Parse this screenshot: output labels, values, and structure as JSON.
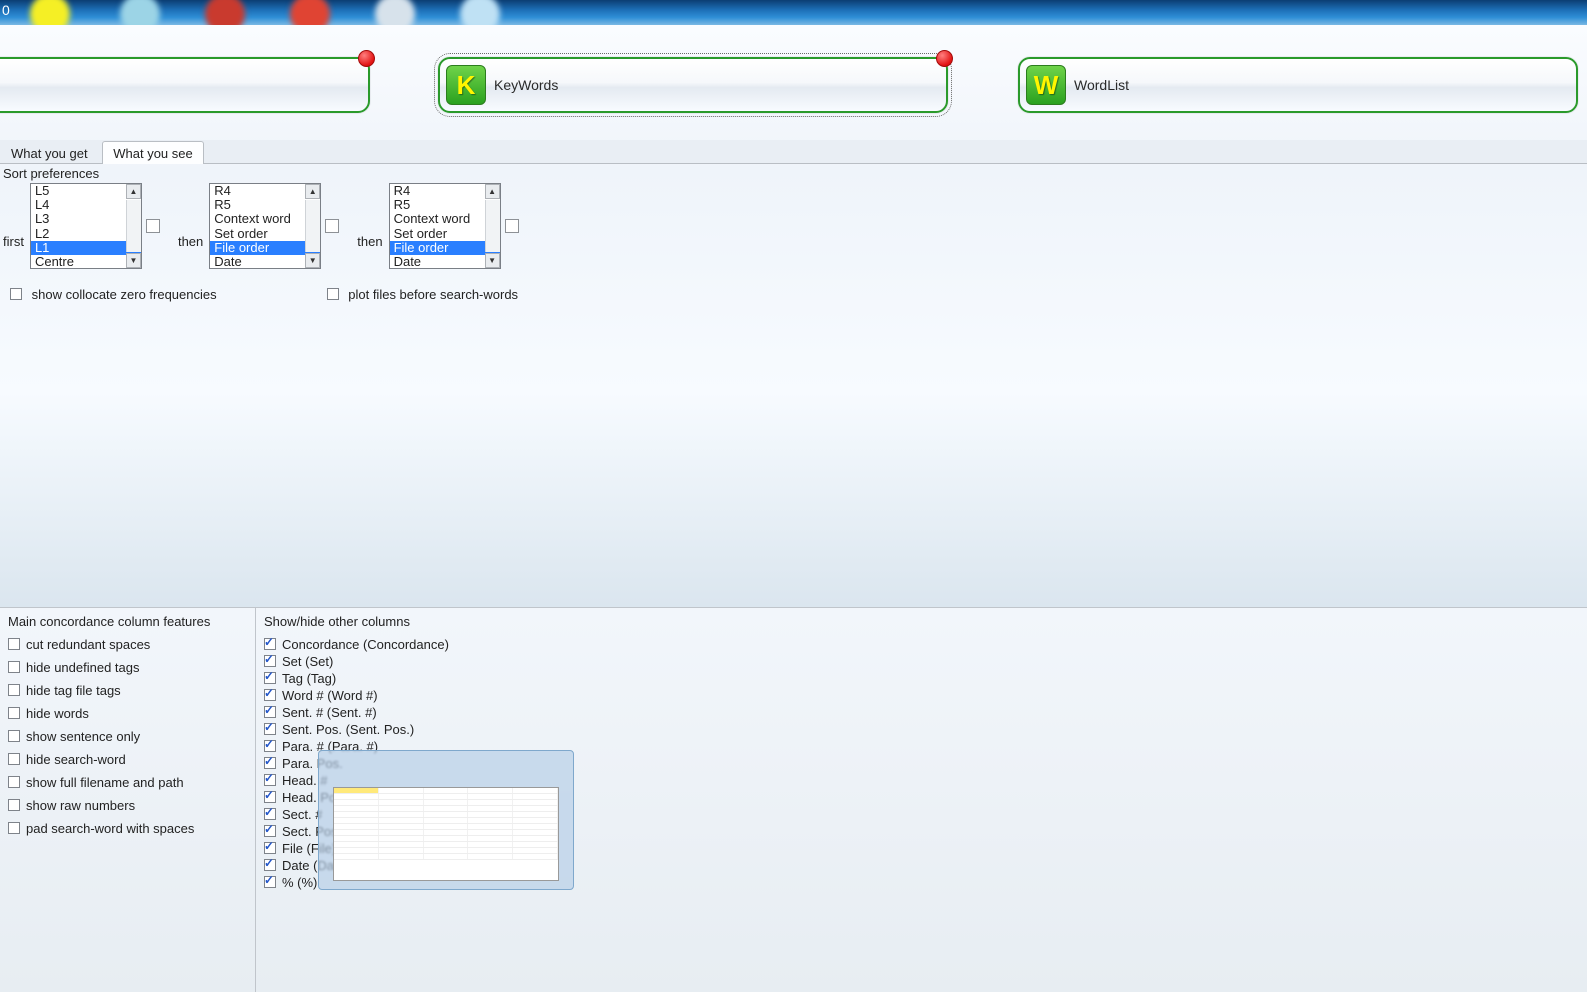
{
  "taskbar": {
    "corner_text": "0"
  },
  "tools": {
    "keywords": {
      "label": "KeyWords",
      "icon_letter": "K"
    },
    "wordlist": {
      "label": "WordList",
      "icon_letter": "W"
    }
  },
  "tabs": {
    "what_you_get": "What you get",
    "what_you_see": "What you see",
    "active": "what_you_see"
  },
  "sort_prefs": {
    "title": "Sort preferences",
    "labels": {
      "first": "first",
      "then1": "then",
      "then2": "then"
    },
    "list1": {
      "items": [
        "L5",
        "L4",
        "L3",
        "L2",
        "L1",
        "Centre"
      ],
      "selected": "L1"
    },
    "list2": {
      "items": [
        "R4",
        "R5",
        "Context word",
        "Set order",
        "File order",
        "Date"
      ],
      "selected": "File order"
    },
    "list3": {
      "items": [
        "R4",
        "R5",
        "Context word",
        "Set order",
        "File order",
        "Date"
      ],
      "selected": "File order"
    }
  },
  "options": {
    "show_collocate_zero": {
      "label": "show collocate zero frequencies",
      "checked": false
    },
    "plot_files_before": {
      "label": "plot files before search-words",
      "checked": false
    }
  },
  "main_col_features": {
    "title": "Main concordance column features",
    "items": [
      {
        "key": "cut_redundant_spaces",
        "label": "cut redundant spaces",
        "checked": false
      },
      {
        "key": "hide_undefined_tags",
        "label": "hide undefined tags",
        "checked": false
      },
      {
        "key": "hide_tag_file_tags",
        "label": "hide tag file tags",
        "checked": false
      },
      {
        "key": "hide_words",
        "label": "hide words",
        "checked": false
      },
      {
        "key": "show_sentence_only",
        "label": "show sentence only",
        "checked": false
      },
      {
        "key": "hide_search_word",
        "label": "hide search-word",
        "checked": false
      },
      {
        "key": "show_full_filename",
        "label": "show full filename and path",
        "checked": false
      },
      {
        "key": "show_raw_numbers",
        "label": "show raw numbers",
        "checked": false
      },
      {
        "key": "pad_search_word",
        "label": "pad search-word with spaces",
        "checked": false
      }
    ]
  },
  "show_hide_columns": {
    "title": "Show/hide other columns",
    "items": [
      {
        "label": "Concordance (Concordance)",
        "checked": true
      },
      {
        "label": "Set (Set)",
        "checked": true
      },
      {
        "label": "Tag (Tag)",
        "checked": true
      },
      {
        "label": "Word # (Word #)",
        "checked": true
      },
      {
        "label": "Sent. # (Sent. #)",
        "checked": true
      },
      {
        "label": "Sent. Pos. (Sent. Pos.)",
        "checked": true
      },
      {
        "label": "Para. # (Para. #)",
        "checked": true
      },
      {
        "label": "Para. Pos.",
        "checked": true
      },
      {
        "label": "Head. #",
        "checked": true
      },
      {
        "label": "Head. Pos.",
        "checked": true
      },
      {
        "label": "Sect. #",
        "checked": true
      },
      {
        "label": "Sect. Pos.",
        "checked": true
      },
      {
        "label": "File (File)",
        "checked": true
      },
      {
        "label": "Date (Date)",
        "checked": true
      },
      {
        "label": "% (%)",
        "checked": true
      }
    ]
  }
}
